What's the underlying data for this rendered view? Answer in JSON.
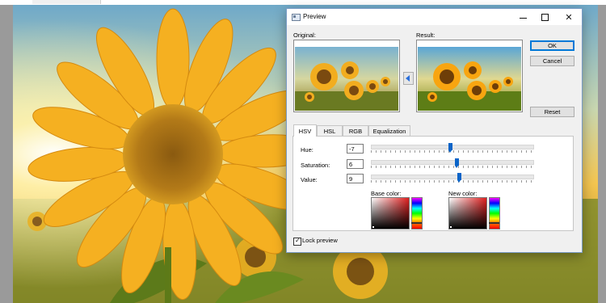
{
  "dialog": {
    "title": "Preview",
    "original_label": "Original:",
    "result_label": "Result:",
    "buttons": {
      "ok": "OK",
      "cancel": "Cancel",
      "reset": "Reset"
    },
    "tabs": [
      {
        "label": "HSV",
        "active": true
      },
      {
        "label": "HSL",
        "active": false
      },
      {
        "label": "RGB",
        "active": false
      },
      {
        "label": "Equalization",
        "active": false
      }
    ],
    "hsv": {
      "hue": {
        "label": "Hue:",
        "value": "-7"
      },
      "saturation": {
        "label": "Saturation:",
        "value": "6"
      },
      "value": {
        "label": "Value:",
        "value": "9"
      }
    },
    "base_color_label": "Base color:",
    "new_color_label": "New color:",
    "lock_preview": {
      "label": "Lock preview",
      "checked": true
    }
  },
  "icons": {
    "app": "window-icon",
    "minimize": "minimize-icon",
    "maximize": "maximize-icon",
    "close": "close-icon",
    "copy_arrow": "arrow-left-icon",
    "check": "checkmark-icon"
  },
  "colors": {
    "accent": "#0078d7",
    "slider_thumb": "#0a64c8",
    "dialog_bg": "#f0f0f0"
  }
}
